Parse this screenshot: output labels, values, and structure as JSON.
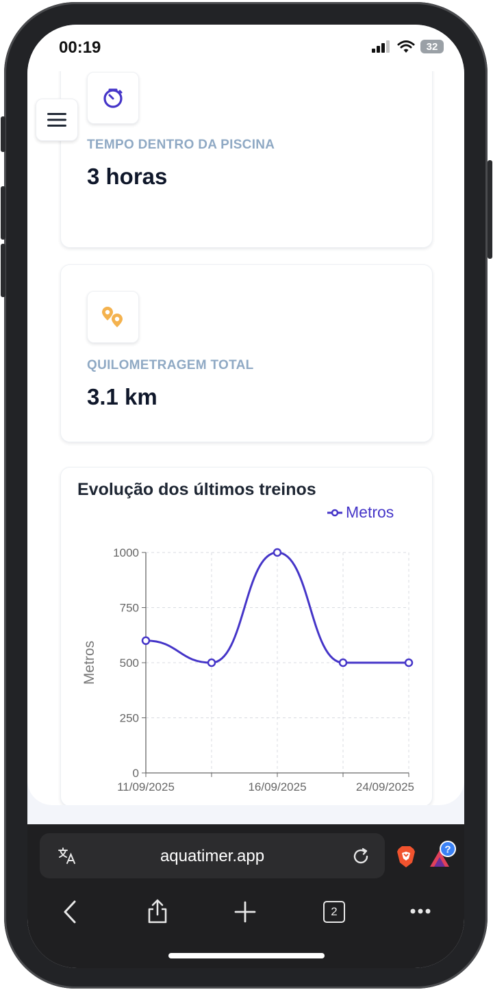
{
  "status": {
    "time": "00:19",
    "battery": "32"
  },
  "cards": [
    {
      "label": "TEMPO DENTRO DA PISCINA",
      "value": "3 horas",
      "icon": "stopwatch-icon"
    },
    {
      "label": "QUILOMETRAGEM TOTAL",
      "value": "3.1 km",
      "icon": "map-pins-icon"
    }
  ],
  "chart": {
    "title": "Evolução dos últimos treinos",
    "legend": "Metros"
  },
  "chart_data": {
    "type": "line",
    "title": "Evolução dos últimos treinos",
    "ylabel": "Metros",
    "ylim": [
      0,
      1000
    ],
    "yticks": [
      "0",
      "250",
      "500",
      "750",
      "1000"
    ],
    "x_tick_labels": [
      "11/09/2025",
      "16/09/2025",
      "24/09/2025"
    ],
    "x_tick_indices": [
      0,
      2,
      4
    ],
    "series": [
      {
        "name": "Metros",
        "color": "#4535c8",
        "values": [
          600,
          500,
          1000,
          500,
          500
        ]
      }
    ],
    "grid": true,
    "legend_position": "top-right"
  },
  "browser": {
    "url": "aquatimer.app",
    "tab_count": "2"
  },
  "colors": {
    "accent": "#4535c8",
    "pin": "#f4b24e"
  }
}
